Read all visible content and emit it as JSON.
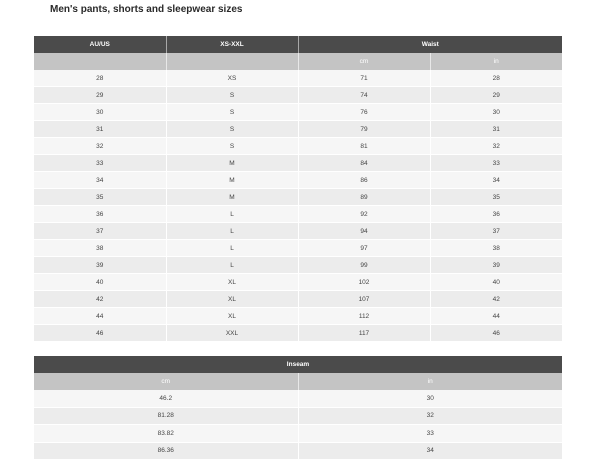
{
  "title": "Men's pants, shorts and sleepwear sizes",
  "waist_table": {
    "headers": {
      "size_au_us": "AU/US",
      "size_range": "XS-XXL",
      "waist": "Waist",
      "cm": "cm",
      "in": "in"
    },
    "rows": [
      [
        "28",
        "XS",
        "71",
        "28"
      ],
      [
        "29",
        "S",
        "74",
        "29"
      ],
      [
        "30",
        "S",
        "76",
        "30"
      ],
      [
        "31",
        "S",
        "79",
        "31"
      ],
      [
        "32",
        "S",
        "81",
        "32"
      ],
      [
        "33",
        "M",
        "84",
        "33"
      ],
      [
        "34",
        "M",
        "86",
        "34"
      ],
      [
        "35",
        "M",
        "89",
        "35"
      ],
      [
        "36",
        "L",
        "92",
        "36"
      ],
      [
        "37",
        "L",
        "94",
        "37"
      ],
      [
        "38",
        "L",
        "97",
        "38"
      ],
      [
        "39",
        "L",
        "99",
        "39"
      ],
      [
        "40",
        "XL",
        "102",
        "40"
      ],
      [
        "42",
        "XL",
        "107",
        "42"
      ],
      [
        "44",
        "XL",
        "112",
        "44"
      ],
      [
        "46",
        "XXL",
        "117",
        "46"
      ]
    ]
  },
  "inseam_table": {
    "headers": {
      "inseam": "Inseam",
      "cm": "cm",
      "in": "in"
    },
    "rows": [
      [
        "46.2",
        "30"
      ],
      [
        "81.28",
        "32"
      ],
      [
        "83.82",
        "33"
      ],
      [
        "86.36",
        "34"
      ]
    ]
  },
  "colors": {
    "header_dark": "#4b4b4b",
    "header_sub": "#c4c4c4",
    "row_odd": "#f6f6f6",
    "row_even": "#ececec"
  }
}
